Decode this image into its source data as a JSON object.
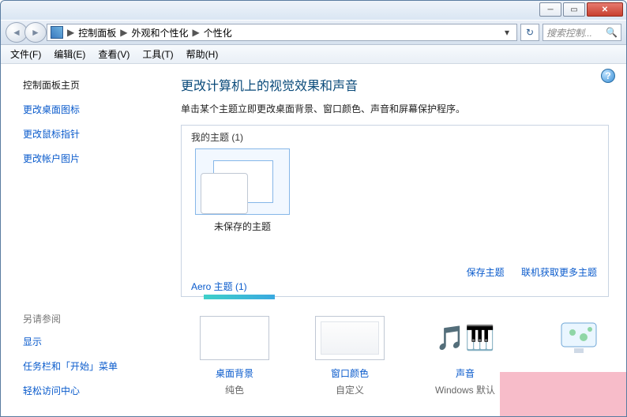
{
  "titlebar": {
    "min": "─",
    "max": "▭",
    "close": "✕"
  },
  "breadcrumb": {
    "b1": "控制面板",
    "b2": "外观和个性化",
    "b3": "个性化",
    "sep": "▶",
    "drop": "▾"
  },
  "refresh_icon": "↻",
  "search": {
    "placeholder": "搜索控制...",
    "icon": "🔍"
  },
  "menu": {
    "file": "文件(F)",
    "edit": "编辑(E)",
    "view": "查看(V)",
    "tools": "工具(T)",
    "help": "帮助(H)"
  },
  "sidebar": {
    "head": "控制面板主页",
    "links": [
      "更改桌面图标",
      "更改鼠标指针",
      "更改帐户图片"
    ],
    "see_also_head": "另请参阅",
    "see_also": [
      "显示",
      "任务栏和「开始」菜单",
      "轻松访问中心"
    ]
  },
  "main": {
    "heading": "更改计算机上的视觉效果和声音",
    "subtext": "单击某个主题立即更改桌面背景、窗口颜色、声音和屏幕保护程序。",
    "my_themes_label": "我的主题 (1)",
    "theme_name": "未保存的主题",
    "save_theme": "保存主题",
    "get_more": "联机获取更多主题",
    "aero_label": "Aero 主题 (1)"
  },
  "bottom": {
    "bg_label": "桌面背景",
    "bg_val": "纯色",
    "wc_label": "窗口颜色",
    "wc_val": "自定义",
    "snd_label": "声音",
    "snd_val": "Windows 默认",
    "sound_glyph": "🎵🎹"
  },
  "help_glyph": "?"
}
